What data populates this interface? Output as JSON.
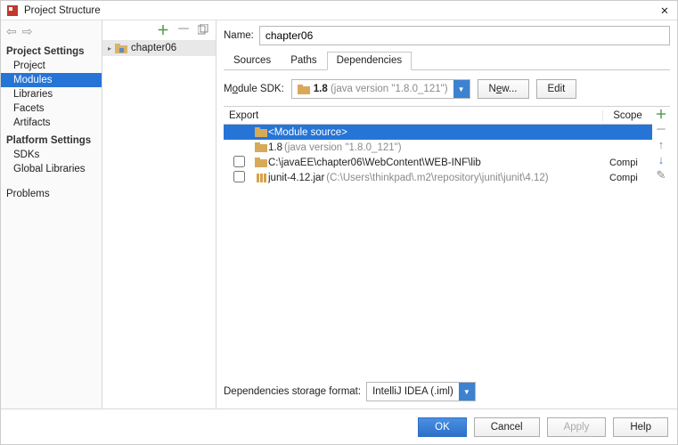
{
  "window": {
    "title": "Project Structure"
  },
  "sidebar": {
    "groups": [
      {
        "title": "Project Settings",
        "items": [
          "Project",
          "Modules",
          "Libraries",
          "Facets",
          "Artifacts"
        ],
        "selected": 1
      },
      {
        "title": "Platform Settings",
        "items": [
          "SDKs",
          "Global Libraries"
        ]
      }
    ],
    "problems": "Problems"
  },
  "module_tree": {
    "name": "chapter06"
  },
  "name_field": {
    "label": "Name:",
    "value": "chapter06"
  },
  "tabs": [
    "Sources",
    "Paths",
    "Dependencies"
  ],
  "active_tab": 2,
  "sdk": {
    "label_pre": "M",
    "label_mid": "o",
    "label_post": "dule SDK:",
    "value_main": "1.8",
    "value_gray": " (java version \"1.8.0_121\")",
    "new_btn_pre": "N",
    "new_btn_mid": "e",
    "new_btn_post": "w...",
    "edit_btn": "Edit"
  },
  "deps_header": {
    "export": "Export",
    "scope": "Scope"
  },
  "deps": [
    {
      "icon": "source",
      "main": "<Module source>",
      "gray": "",
      "cb": false,
      "scope": "",
      "selected": true
    },
    {
      "icon": "sdk",
      "main": "1.8 ",
      "gray": "(java version \"1.8.0_121\")",
      "cb": false,
      "scope": ""
    },
    {
      "icon": "folder",
      "main": "C:\\javaEE\\chapter06\\WebContent\\WEB-INF\\lib",
      "gray": "",
      "cb": true,
      "scope": "Compi"
    },
    {
      "icon": "jar",
      "main": "junit-4.12.jar ",
      "gray": "(C:\\Users\\thinkpad\\.m2\\repository\\junit\\junit\\4.12)",
      "cb": true,
      "scope": "Compi"
    }
  ],
  "storage": {
    "label": "Dependencies storage format:",
    "value": "IntelliJ IDEA (.iml)"
  },
  "footer": {
    "ok": "OK",
    "cancel": "Cancel",
    "apply": "Apply",
    "help": "Help"
  }
}
